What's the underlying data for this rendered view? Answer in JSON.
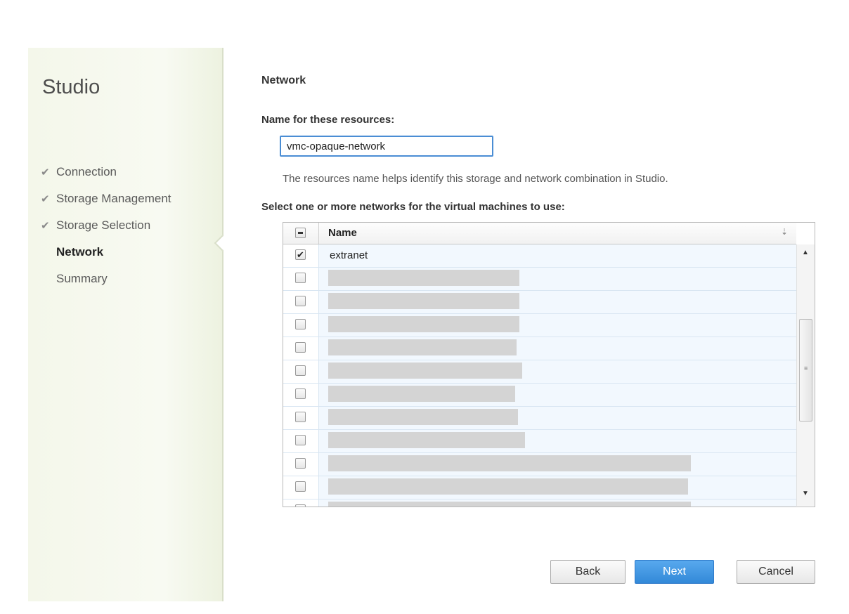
{
  "app": {
    "title": "Studio"
  },
  "wizard_steps": [
    {
      "label": "Connection",
      "state": "done"
    },
    {
      "label": "Storage Management",
      "state": "done"
    },
    {
      "label": "Storage Selection",
      "state": "done"
    },
    {
      "label": "Network",
      "state": "current"
    },
    {
      "label": "Summary",
      "state": "pending"
    }
  ],
  "page": {
    "section_title": "Network",
    "name_label": "Name for these resources:",
    "name_value": "vmc-opaque-network",
    "hint": "The resources name helps identify this storage and network combination in Studio.",
    "list_label": "Select one or more networks for the virtual machines to use:"
  },
  "network_table": {
    "column_header": "Name",
    "rows": [
      {
        "name": "extranet",
        "checked": true
      },
      {
        "name": "",
        "checked": false,
        "redacted": true
      },
      {
        "name": "",
        "checked": false,
        "redacted": true
      },
      {
        "name": "",
        "checked": false,
        "redacted": true
      },
      {
        "name": "",
        "checked": false,
        "redacted": true
      },
      {
        "name": "",
        "checked": false,
        "redacted": true
      },
      {
        "name": "",
        "checked": false,
        "redacted": true
      },
      {
        "name": "",
        "checked": false,
        "redacted": true
      },
      {
        "name": "",
        "checked": false,
        "redacted": true
      },
      {
        "name": "",
        "checked": false,
        "redacted": true
      },
      {
        "name": "",
        "checked": false,
        "redacted": true
      },
      {
        "name": "",
        "checked": false,
        "redacted": true
      }
    ]
  },
  "buttons": {
    "back": "Back",
    "next": "Next",
    "cancel": "Cancel"
  },
  "icons": {
    "check": "checkmark-icon",
    "sort": "sort-arrow-icon"
  },
  "colors": {
    "accent": "#3289d8",
    "row_bg": "#f2f8fe"
  }
}
